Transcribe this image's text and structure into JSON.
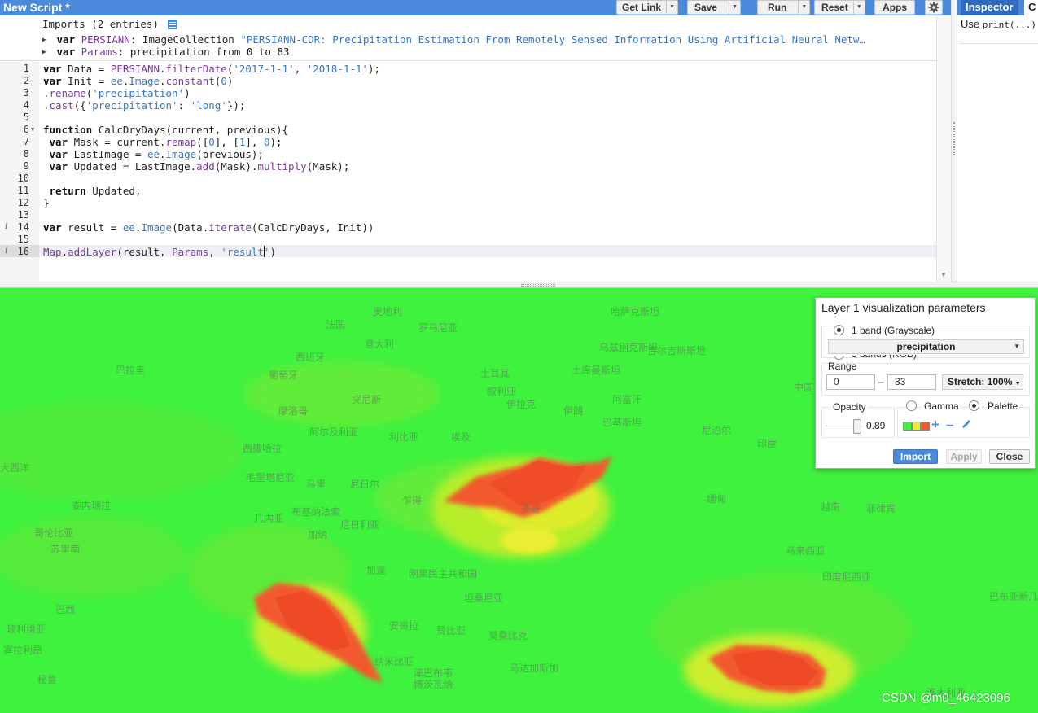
{
  "header": {
    "title": "New Script *",
    "buttons": [
      {
        "label": "Get Link",
        "has_dropdown": true
      },
      {
        "label": "Save",
        "has_dropdown": true
      },
      {
        "label": "Run",
        "has_dropdown": true
      },
      {
        "label": "Reset",
        "has_dropdown": true
      },
      {
        "label": "Apps",
        "has_dropdown": false
      }
    ],
    "settings_icon": "gear-icon"
  },
  "right_panel": {
    "tabs": [
      "Inspector",
      "Console"
    ],
    "tab_visible": "C",
    "hint_prefix": "Use ",
    "hint_code": "print(...)"
  },
  "imports": {
    "header": "Imports (2 entries)",
    "entries": [
      {
        "keyword": "var",
        "name": "PERSIANN",
        "type": "ImageCollection",
        "value": "\"PERSIANN-CDR: Precipitation Estimation From Remotely Sensed Information Using Artificial Neural Netw…"
      },
      {
        "keyword": "var",
        "name": "Params",
        "type": "",
        "value": "precipitation from 0 to 83"
      }
    ]
  },
  "editor": {
    "active_line": 16,
    "info_lines": [
      14,
      16
    ],
    "fold_lines": [
      6
    ],
    "lines": [
      "var Data = PERSIANN.filterDate('2017-1-1', '2018-1-1');",
      "var Init = ee.Image.constant(0)",
      ".rename('precipitation')",
      ".cast({'precipitation': 'long'});",
      "",
      "function CalcDryDays(current, previous){",
      " var Mask = current.remap([0], [1], 0);",
      " var LastImage = ee.Image(previous);",
      " var Updated = LastImage.add(Mask).multiply(Mask);",
      "",
      " return Updated;",
      "}",
      "",
      "var result = ee.Image(Data.iterate(CalcDryDays, Init))",
      "",
      "Map.addLayer(result, Params, 'result')"
    ]
  },
  "map": {
    "labels": [
      "法国",
      "奥地利",
      "罗马尼亚",
      "哈萨克斯坦",
      "西班牙",
      "意大利",
      "乌兹别克斯坦",
      "吉尔吉斯斯坦",
      "葡萄牙",
      "土耳其",
      "土库曼斯坦",
      "中国",
      "突尼斯",
      "叙利亚",
      "伊拉克",
      "阿富汗",
      "摩洛哥",
      "伊朗",
      "巴基斯坦",
      "阿尔及利亚",
      "利比亚",
      "埃及",
      "尼泊尔",
      "西撒哈拉",
      "印度",
      "毛里塔尼亚",
      "马里",
      "尼日尔",
      "乍得",
      "缅甸",
      "越南",
      "菲律宾",
      "布基纳法索",
      "几内亚",
      "尼日利亚",
      "加纳",
      "马来西亚",
      "加蓬",
      "刚果民主共和国",
      "坦桑尼亚",
      "印度尼西亚",
      "巴布亚新几内亚",
      "安哥拉",
      "赞比亚",
      "莫桑比克",
      "纳米比亚",
      "津巴布韦",
      "马达加斯加",
      "博茨瓦纳",
      "澳大利亚",
      "巴西",
      "塞拉利昂",
      "秘鲁",
      "玻利维亚",
      "巴拉圭",
      "大西洋",
      "苏里南",
      "哥伦比亚",
      "委内瑞拉",
      "多哥"
    ],
    "colors": {
      "background": "#3ef23e",
      "mid": "#7df233",
      "yellow": "#d6ec2f",
      "red": "#f25a2e"
    }
  },
  "viz_dialog": {
    "title": "Layer 1 visualization parameters",
    "band_options": [
      "1 band (Grayscale)",
      "3 bands (RGB)"
    ],
    "band_selected": "precipitation",
    "range_label": "Range",
    "range_min": "0",
    "range_separator": "–",
    "range_max": "83",
    "stretch_label": "Stretch: 100%",
    "opacity_label": "Opacity",
    "opacity_value": "0.89",
    "opacity": 0.89,
    "mode_options": [
      "Gamma",
      "Palette"
    ],
    "mode_selected": "Palette",
    "palette": [
      "#3ef23e",
      "#e6f21e",
      "#f25a2e"
    ],
    "buttons": {
      "import": "Import",
      "apply": "Apply",
      "close": "Close"
    }
  },
  "watermark": "CSDN @m0_46423096"
}
